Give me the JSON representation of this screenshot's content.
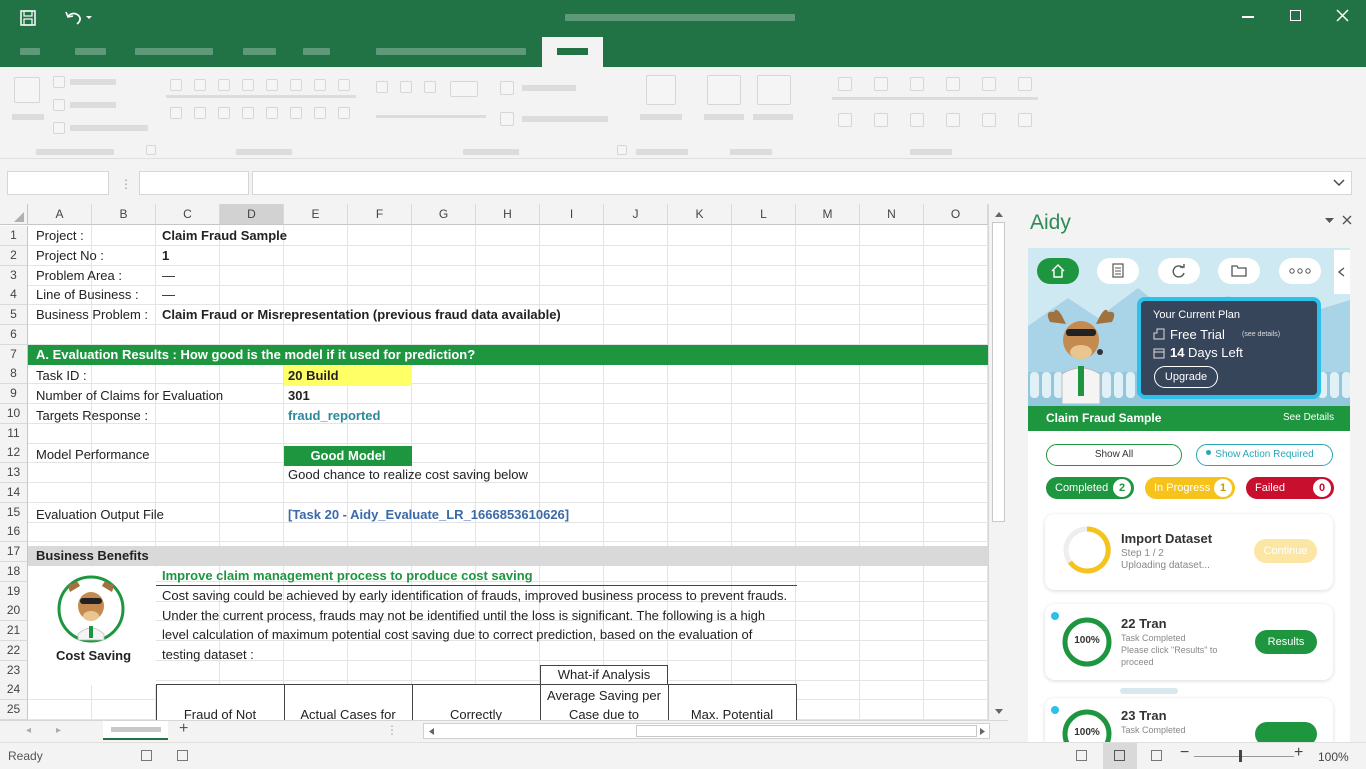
{
  "sheet": {
    "columns": [
      "A",
      "B",
      "C",
      "D",
      "E",
      "F",
      "G",
      "H",
      "I",
      "J",
      "K",
      "L",
      "M",
      "N",
      "O"
    ],
    "rows": [
      "1",
      "2",
      "3",
      "4",
      "5",
      "6",
      "7",
      "8",
      "9",
      "10",
      "11",
      "12",
      "13",
      "14",
      "15",
      "16",
      "17",
      "18",
      "19",
      "20",
      "21",
      "22",
      "23",
      "24",
      "25"
    ],
    "project_label": "Project :",
    "project_value": "Claim Fraud Sample",
    "project_no_label": "Project No :",
    "project_no_value": "1",
    "problem_area_label": "Problem Area :",
    "problem_area_value": "—",
    "line_of_business_label": "Line of Business :",
    "line_of_business_value": "—",
    "business_problem_label": "Business Problem :",
    "business_problem_value": "Claim Fraud or Misrepresentation (previous fraud data available)",
    "section_a": "A. Evaluation Results : How good is the model if it used for prediction?",
    "task_id_label": "Task ID :",
    "task_id_value": "20 Build",
    "num_claims_label": "Number of Claims for Evaluation",
    "num_claims_value": "301",
    "targets_label": "Targets Response :",
    "targets_value": "fraud_reported",
    "model_perf_label": "Model Performance",
    "model_perf_value": "Good Model",
    "model_perf_note": "Good chance to realize cost saving below",
    "eval_output_label": "Evaluation Output File",
    "eval_output_value": "[Task 20 - Aidy_Evaluate_LR_1666853610626]",
    "business_benefits": "Business Benefits",
    "improve_title": "Improve claim management process to produce cost saving",
    "para_line1": "Cost saving could be achieved by early identification of frauds, improved business process to prevent frauds.",
    "para_line2": "Under the current process, frauds may not be identified until the loss is significant. The following is a high",
    "para_line3": "level calculation of maximum potential cost saving due to correct prediction, based on the evaluation of",
    "para_line4": "testing dataset :",
    "cost_saving_label": "Cost Saving",
    "whatif_label": "What-if Analysis",
    "table_headers": [
      "Fraud of Not",
      "Actual Cases for",
      "Correctly",
      "Average Saving per Case due to",
      "Max. Potential"
    ]
  },
  "status": {
    "ready": "Ready",
    "zoom": "100%"
  },
  "aidy": {
    "title": "Aidy",
    "plan_title": "Your Current Plan",
    "plan_type": "Free Trial",
    "plan_see_details": "(see details)",
    "days_num": "14",
    "days_label": "Days Left",
    "upgrade": "Upgrade",
    "project_name": "Claim Fraud Sample",
    "see_details": "See Details",
    "show_all": "Show All",
    "show_action_required": "Show Action Required",
    "completed_label": "Completed",
    "completed_count": "2",
    "in_progress_label": "In Progress",
    "in_progress_count": "1",
    "failed_label": "Failed",
    "failed_count": "0",
    "card1": {
      "title": "Import Dataset",
      "step": "Step 1 / 2",
      "status": "Uploading dataset...",
      "button": "Continue"
    },
    "card2": {
      "title": "22 Tran",
      "percent": "100%",
      "line1": "Task Completed",
      "line2": "Please click \"Results\" to",
      "line3": "proceed",
      "button": "Results"
    },
    "card3": {
      "title": "23 Tran",
      "percent": "100%",
      "line1": "Task Completed"
    }
  },
  "colors": {
    "excel_green": "#217346",
    "accent_green": "#1e9640",
    "highlight_yellow": "#ffff66",
    "aidy_teal": "#2aa6b8",
    "in_progress": "#f6c21c",
    "failed": "#c8102e"
  }
}
